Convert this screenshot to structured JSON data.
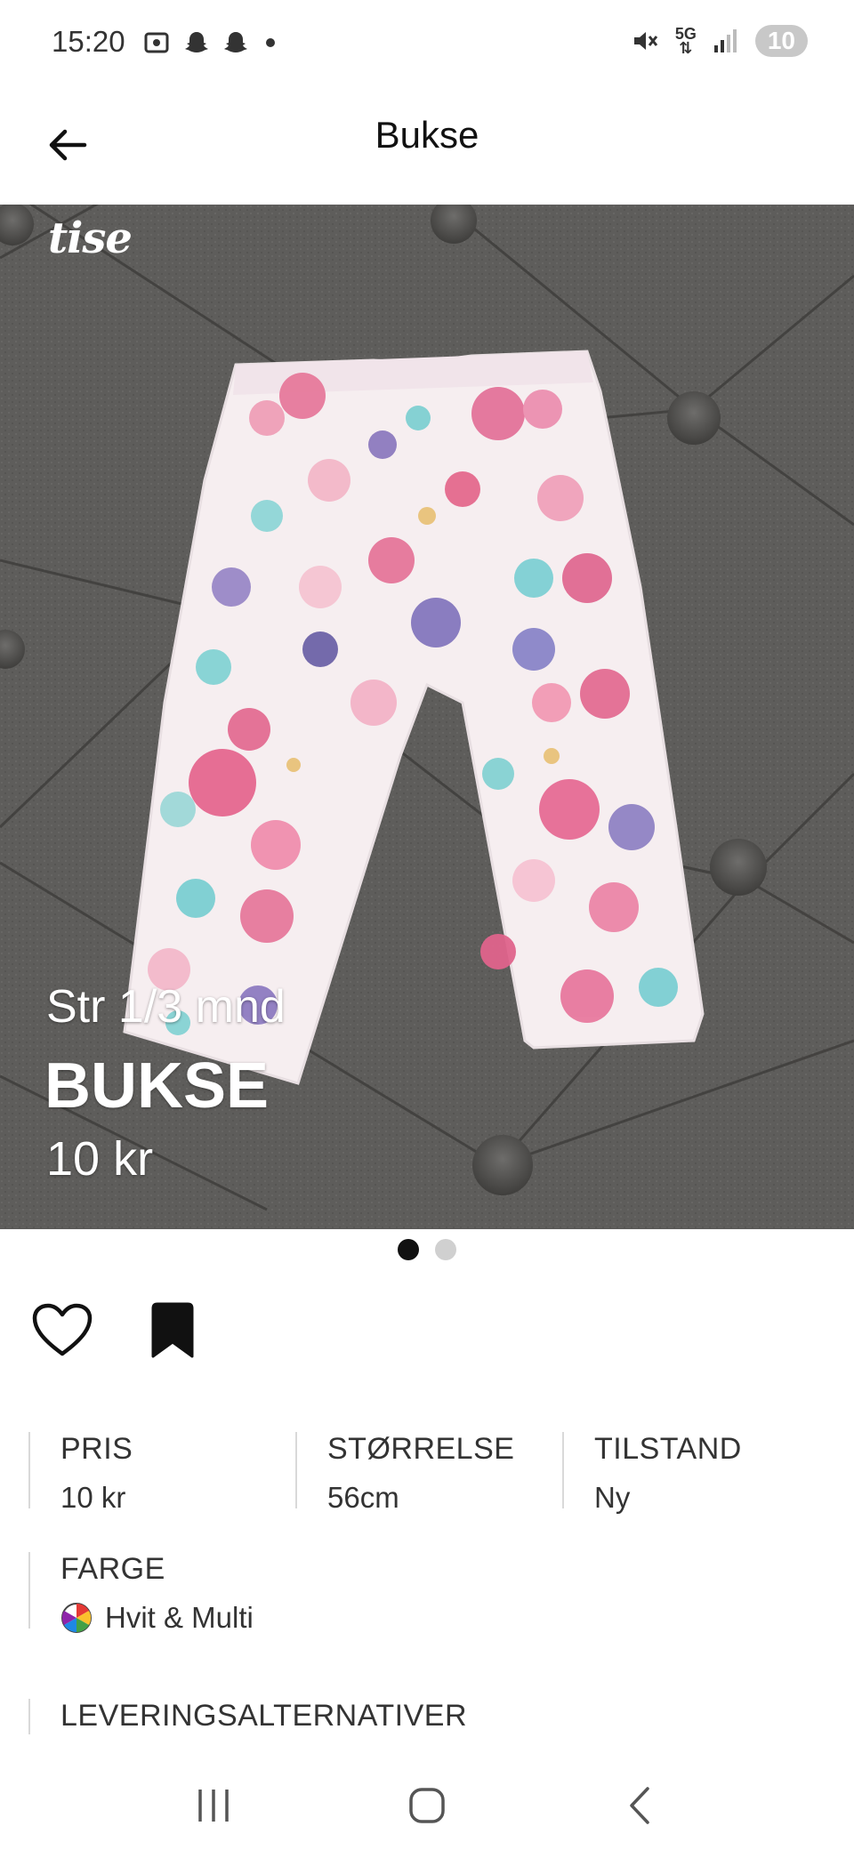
{
  "status_bar": {
    "time": "15:20",
    "left_icons": [
      "screenshot-icon",
      "snapchat-icon",
      "snapchat-icon",
      "dot-icon"
    ],
    "right_icons": [
      "mute-icon",
      "5g-icon",
      "signal-icon"
    ],
    "network_label": "5G",
    "battery": "10"
  },
  "app_bar": {
    "title": "Bukse",
    "back_icon": "arrow-left-icon"
  },
  "hero": {
    "logo": "tise",
    "overlay_subtitle": "Str 1/3 mnd",
    "overlay_title": "BUKSE",
    "overlay_price": "10 kr",
    "image_count": 2,
    "active_image": 1
  },
  "actions": {
    "like_icon": "heart-icon",
    "save_icon": "bookmark-icon"
  },
  "attributes": [
    {
      "label": "PRIS",
      "value": "10 kr"
    },
    {
      "label": "STØRRELSE",
      "value": "56cm"
    },
    {
      "label": "TILSTAND",
      "value": "Ny"
    }
  ],
  "color": {
    "label": "FARGE",
    "value": "Hvit & Multi",
    "icon": "color-wheel-icon"
  },
  "delivery": {
    "label": "LEVERINGSALTERNATIVER"
  },
  "nav_bar": {
    "buttons": [
      "recents-icon",
      "home-icon",
      "back-icon"
    ]
  }
}
